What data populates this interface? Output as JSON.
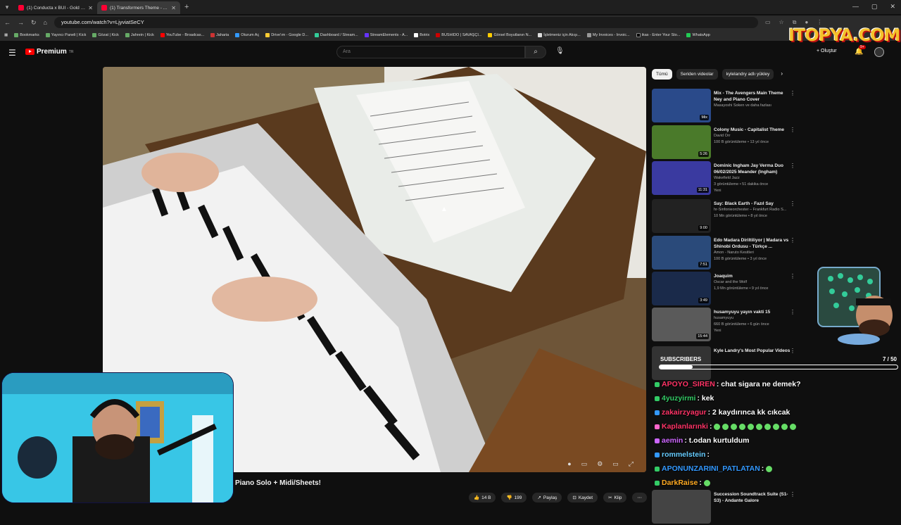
{
  "browser": {
    "tabs": [
      {
        "title": "(1) Conducta x BUI - Gold (Offi",
        "active": false
      },
      {
        "title": "(1) Transformers Theme - Arriv",
        "active": true
      }
    ],
    "url": "youtube.com/watch?v=LjyviatSeCY",
    "bookmarks": [
      "Bookmarks",
      "Yayıncı Paneli | Kick",
      "Gözat | Kick",
      "Jahrein | Kick",
      "YouTube - Broadcas...",
      "Jaharia",
      "Oturum Aç",
      "Drive'ım - Google D...",
      "Dashboard / Stream...",
      "StreamElements - A...",
      "Botrix",
      "BUSHIDO | SAVAŞÇI...",
      "Görsel Boyutlanın N...",
      "İşletmeniz için Akışı...",
      "My Invoices - Invoic...",
      "ikas - Enter Your Sto...",
      "WhatsApp"
    ]
  },
  "youtube": {
    "logo_text": "Premium",
    "logo_sup": "TR",
    "search_placeholder": "Ara",
    "create_label": "Oluştur",
    "notif_count": "9+"
  },
  "watermark": "ITOPYA.COM",
  "video": {
    "title": "Piano Solo + Midi/Sheets!",
    "likes": "14 B",
    "dislikes": "199",
    "share": "Paylaş",
    "save": "Kaydet",
    "clip": "Klip"
  },
  "chips": [
    "Tümü",
    "Seriden videolar",
    "kylelandry adlı yükley"
  ],
  "recommendations": [
    {
      "title": "Mix - The Avengers Main Theme Ney and Piano Cover",
      "channel": "Masayoshi Soken ve daha fazlası",
      "meta": "",
      "duration": "Mix",
      "color": "#2a4a8a"
    },
    {
      "title": "Colony Music - Capitalist Theme",
      "channel": "David Orr",
      "meta": "100 B görüntüleme • 13 yıl önce",
      "duration": "5:26",
      "color": "#4a7a2a"
    },
    {
      "title": "Dominic Ingham Jay Verma Duo 06/02/2025 Meander (Ingham)",
      "channel": "Wakefield Jazz",
      "meta": "3 görüntüleme • 51 dakika önce",
      "extra": "Yeni",
      "duration": "11:31",
      "color": "#3a3aa0"
    },
    {
      "title": "Say: Black Earth - Fazıl Say",
      "channel": "hr-Sinfonieorchester – Frankfurt Radio S...",
      "meta": "10 Mn görüntüleme • 8 yıl önce",
      "duration": "9:00",
      "color": "#222222"
    },
    {
      "title": "Edo Madara Diriltiliyor | Madara vs Shinobi Ordusu - Türkçe ...",
      "channel": "Amon - Naruto Kesitleri",
      "meta": "100 B görüntüleme • 3 yıl önce",
      "duration": "7:51",
      "color": "#2a4a7a"
    },
    {
      "title": "Joaquim",
      "channel": "Oscar and the Wolf",
      "meta": "1,9 Mn görüntüleme • 9 yıl önce",
      "duration": "3:49",
      "color": "#1a2a4a"
    },
    {
      "title": "husamyuyu yayın vakti 15",
      "channel": "husamyuyu",
      "meta": "660 B görüntüleme • 6 gün önce",
      "extra": "Yeni",
      "duration": "15:44",
      "color": "#5a5a5a"
    },
    {
      "title": "Kyle Landry's Most Popular Videos",
      "channel": "",
      "meta": "",
      "duration": "",
      "color": "#333333"
    },
    {
      "title": "Succession Soundtrack Suite (S1-S3) - Andante Galore",
      "channel": "",
      "meta": "",
      "duration": "",
      "color": "#444444"
    }
  ],
  "subscribers": {
    "label": "SUBSCRIBERS",
    "count": "7 / 50",
    "progress": 0.14
  },
  "chat": [
    {
      "user": "APOYO_SIREN",
      "text": ": chat sigara ne demek?",
      "color": "#ff3366",
      "badge": "#33cc66"
    },
    {
      "user": "4yuzyirmi",
      "text": ": kek",
      "color": "#33cc66",
      "badge": "#33cc66"
    },
    {
      "user": "zakairzyagur",
      "text": ": 2 kaydırınca kk cıkcak",
      "color": "#ff3366",
      "badge": "#3399ff"
    },
    {
      "user": "Kaplanlarınki",
      "text": ":",
      "color": "#ff3366",
      "badge": "#ff66cc",
      "emotes": 10
    },
    {
      "user": "aemin",
      "text": ": t.odan kurtuldum",
      "color": "#cc66ff",
      "badge": "#cc66ff"
    },
    {
      "user": "rommelstein",
      "text": ":",
      "color": "#66ccff",
      "badge": "#3399ff"
    },
    {
      "user": "APONUNZARINI_PATLATAN",
      "text": ":",
      "color": "#3399ff",
      "badge": "#33cc66",
      "emotes": 1
    },
    {
      "user": "DarkRaise",
      "text": ":",
      "color": "#ffaa22",
      "badge": "#33cc66",
      "emotes": 1
    }
  ]
}
